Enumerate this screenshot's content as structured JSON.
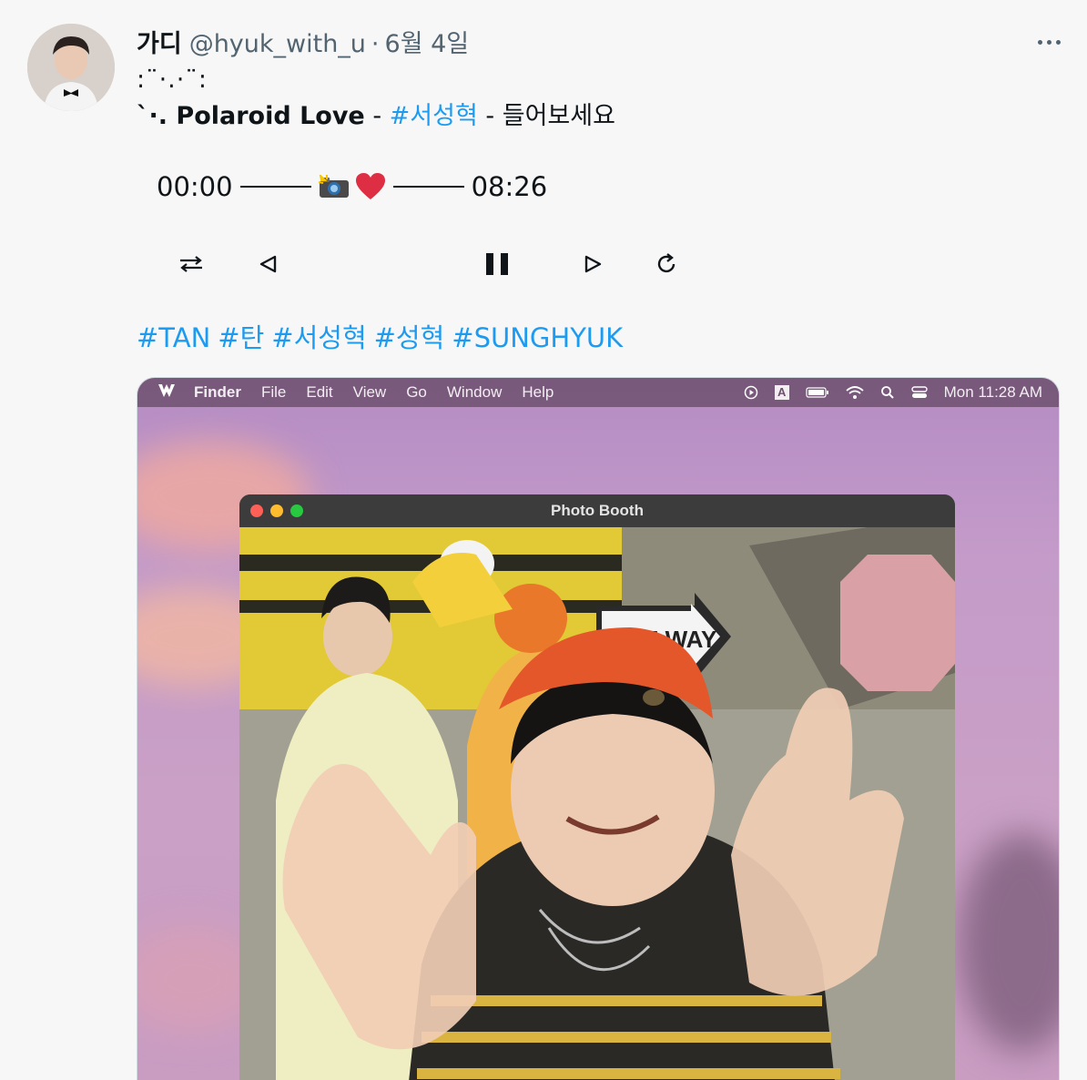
{
  "tweet": {
    "display_name": "가디",
    "handle": "@hyuk_with_u",
    "separator": "·",
    "date": "6월 4일",
    "deco_line": ":¨·.·¨:",
    "title_prefix": "`·. ",
    "song_title": "Polaroid Love",
    "dash1": " - ",
    "artist_tag": "#서성혁",
    "dash2": " - 들어보세요",
    "player": {
      "time_start": "00:00",
      "time_end": "08:26"
    },
    "controls": {
      "shuffle": "shuffle-icon",
      "prev": "previous-icon",
      "pause": "pause-icon",
      "next": "next-icon",
      "repeat": "repeat-icon"
    },
    "hashtags": [
      "#TAN",
      "#탄",
      "#서성혁",
      "#성혁",
      "#SUNGHYUK"
    ]
  },
  "media": {
    "menubar": {
      "app": "Finder",
      "items": [
        "File",
        "Edit",
        "View",
        "Go",
        "Window",
        "Help"
      ],
      "input_badge": "A",
      "clock": "Mon 11:28 AM"
    },
    "window_title": "Photo Booth",
    "scene_text": "ONE WAY"
  },
  "colors": {
    "link": "#1d9bf0",
    "muted": "#536471",
    "heart": "#e0245e"
  }
}
